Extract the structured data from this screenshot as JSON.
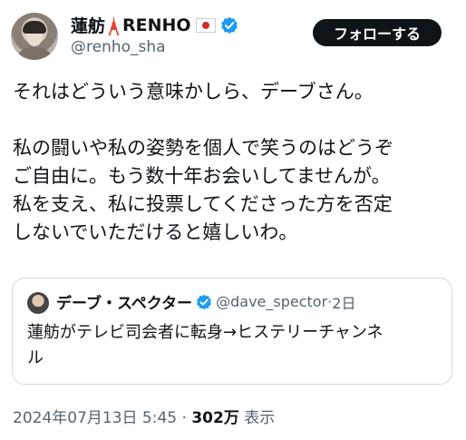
{
  "author": {
    "name": "蓮舫",
    "name_suffix": "RENHO",
    "handle": "@renho_sha"
  },
  "follow_label": "フォローする",
  "body": [
    "それはどういう意味かしら、デーブさん。",
    "",
    "私の闘いや私の姿勢を個人で笑うのはどうぞ",
    "ご自由に。もう数十年お会いしてませんが。",
    "私を支え、私に投票してくださった方を否定",
    "しないでいただけると嬉しいわ。"
  ],
  "quote": {
    "name": "デーブ・スペクター",
    "handle": "@dave_spector",
    "separator": "·",
    "age": "2日",
    "text_line1": "蓮舫がテレビ司会者に転身→ヒステリーチャンネ",
    "text_line2": "ル"
  },
  "meta": {
    "timestamp": "2024年07月13日 5:45",
    "separator": " · ",
    "views": "302万",
    "views_label": " 表示"
  },
  "colors": {
    "text": "#0f1419",
    "secondary": "#536471",
    "verified": "#1d9bf0",
    "border": "#cfd9de"
  },
  "icons": [
    "tokyo-tower-icon",
    "japan-flag-icon",
    "verified-badge-icon"
  ]
}
